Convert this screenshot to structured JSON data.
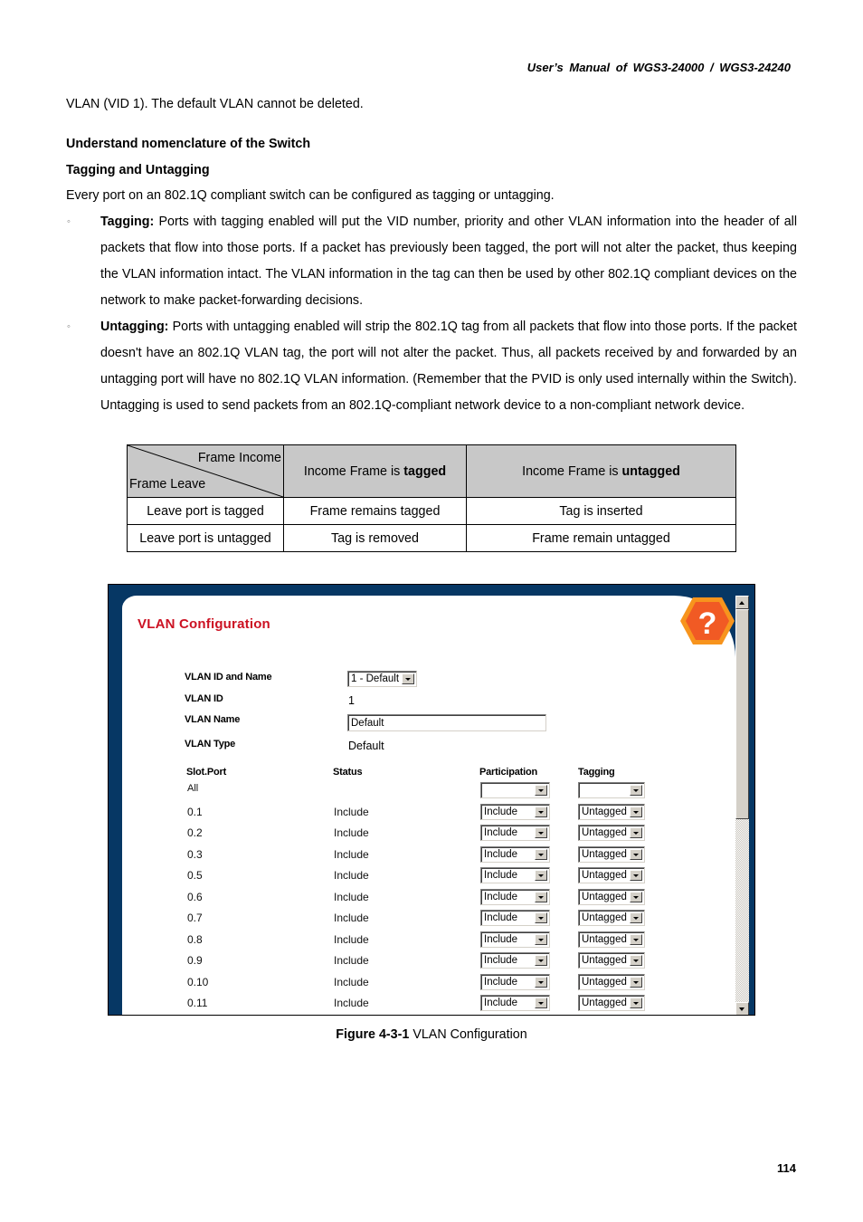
{
  "header": {
    "title": "User’s Manual of WGS3-24000 / WGS3-24240"
  },
  "body": {
    "intro": "VLAN (VID 1). The default VLAN cannot be deleted.",
    "heading_nomenclature": "Understand nomenclature of the Switch",
    "heading_tagging": "Tagging and Untagging",
    "paragraph": "Every port on an 802.1Q compliant switch can be configured as tagging or untagging.",
    "bullets": [
      {
        "marker": "◦",
        "term": "Tagging:",
        "text": " Ports with tagging enabled will put the VID number, priority and other VLAN information into the header of all packets that flow into those ports. If a packet has previously been tagged, the port will not alter the packet, thus keeping the VLAN information intact. The VLAN information in the tag can then be used by other 802.1Q compliant devices on the network to make packet-forwarding decisions."
      },
      {
        "marker": "◦",
        "term": "Untagging:",
        "text": " Ports with untagging enabled will strip the 802.1Q tag from all packets that flow into those ports. If the packet doesn't have an 802.1Q VLAN tag, the port will not alter the packet. Thus, all packets received by and forwarded by an untagging port will have no 802.1Q VLAN information. (Remember that the PVID is only used internally within the Switch). Untagging is used to send packets from an 802.1Q-compliant network device to a non-compliant network device."
      }
    ]
  },
  "frame_table": {
    "corner_top": "Frame Income",
    "corner_bottom": "Frame Leave",
    "col_headers": [
      {
        "prefix": "Income Frame is ",
        "emphasis": "tagged"
      },
      {
        "prefix": "Income Frame is ",
        "emphasis": "untagged"
      }
    ],
    "rows": [
      {
        "label": "Leave port is tagged",
        "cells": [
          "Frame remains tagged",
          "Tag is inserted"
        ]
      },
      {
        "label": "Leave port is untagged",
        "cells": [
          "Tag is removed",
          "Frame remain untagged"
        ]
      }
    ]
  },
  "screenshot": {
    "title": "VLAN Configuration",
    "help_icon": "?",
    "colors": {
      "frame": "#063764",
      "title": "#cc1122",
      "help_outer": "#f7941d",
      "help_inner": "#f15a24"
    },
    "fields": {
      "vlan_id_and_name": {
        "label": "VLAN ID and Name",
        "selected": "1 - Default"
      },
      "vlan_id": {
        "label": "VLAN ID",
        "value": "1"
      },
      "vlan_name": {
        "label": "VLAN Name",
        "value": "Default"
      },
      "vlan_type": {
        "label": "VLAN Type",
        "value": "Default"
      }
    },
    "port_table": {
      "headers": {
        "slot_port": "Slot.Port",
        "status": "Status",
        "participation": "Participation",
        "tagging": "Tagging"
      },
      "all_row": {
        "port": "All",
        "participation": "",
        "tagging": ""
      },
      "rows": [
        {
          "port": "0.1",
          "status": "Include",
          "participation": "Include",
          "tagging": "Untagged"
        },
        {
          "port": "0.2",
          "status": "Include",
          "participation": "Include",
          "tagging": "Untagged"
        },
        {
          "port": "0.3",
          "status": "Include",
          "participation": "Include",
          "tagging": "Untagged"
        },
        {
          "port": "0.5",
          "status": "Include",
          "participation": "Include",
          "tagging": "Untagged"
        },
        {
          "port": "0.6",
          "status": "Include",
          "participation": "Include",
          "tagging": "Untagged"
        },
        {
          "port": "0.7",
          "status": "Include",
          "participation": "Include",
          "tagging": "Untagged"
        },
        {
          "port": "0.8",
          "status": "Include",
          "participation": "Include",
          "tagging": "Untagged"
        },
        {
          "port": "0.9",
          "status": "Include",
          "participation": "Include",
          "tagging": "Untagged"
        },
        {
          "port": "0.10",
          "status": "Include",
          "participation": "Include",
          "tagging": "Untagged"
        },
        {
          "port": "0.11",
          "status": "Include",
          "participation": "Include",
          "tagging": "Untagged"
        }
      ]
    },
    "scrollbar": {
      "position_fraction": 0.0
    }
  },
  "caption": {
    "label": "Figure 4-3-1",
    "text": " VLAN Configuration"
  },
  "page_number": "114"
}
